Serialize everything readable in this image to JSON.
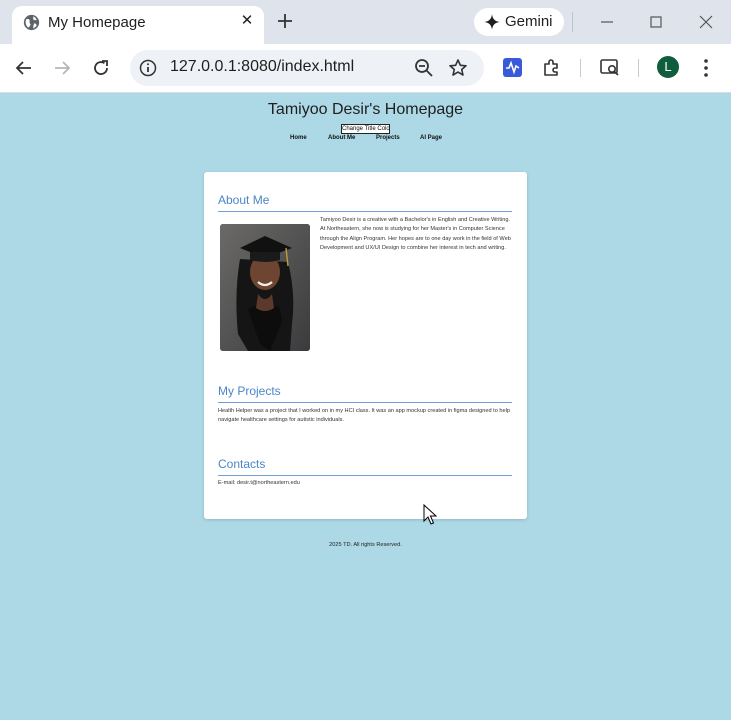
{
  "browser": {
    "tab_title": "My Homepage",
    "tab_close": "✕",
    "gemini_label": "Gemini",
    "url": "127.0.0.1:8080/index.html",
    "profile_initial": "L"
  },
  "page": {
    "title": "Tamiyoo Desir's Homepage",
    "change_color_button": "Change Title Color",
    "nav": [
      "Home",
      "About Me",
      "Projects",
      "AI Page"
    ],
    "about": {
      "heading": "About Me",
      "text": "Tamiyoo Desir is a creative with a Bachelor's in English and Creative Writing. At Northeastern, she now is studying for her Master's in Computer Science through the Align Program. Her hopes are to one day work in the field of Web Development and UX/UI Design to combine her interest in tech and writing."
    },
    "projects": {
      "heading": "My Projects",
      "text": "Health Helper was a project that I worked on in my HCI class. It was an app mockup created in figma designed to help navigate healthcare settings for autistic individuals."
    },
    "contacts": {
      "heading": "Contacts",
      "text": "E-mail: desir.t@northeastern.edu"
    },
    "footer": "2025 TD. All rights Reserved."
  },
  "colors": {
    "page_background": "#add8e6",
    "heading_blue": "#4a86c8",
    "chrome_tabbar": "#dfe3eb"
  }
}
